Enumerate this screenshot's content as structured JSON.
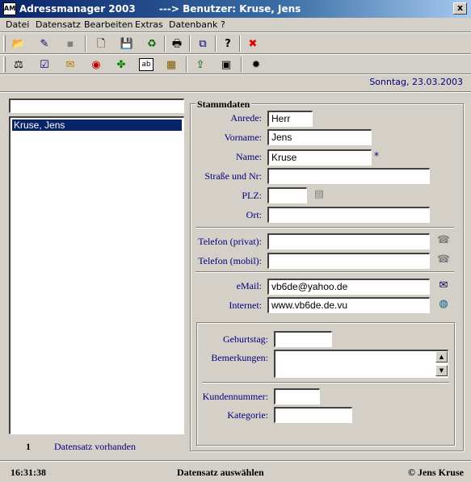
{
  "window": {
    "title": "Adressmanager 2003       ---> Benutzer: Kruse, Jens",
    "close_label": "x",
    "icon_label": "AM"
  },
  "menu": [
    "Datei",
    "Datensatz",
    "Bearbeiten",
    "Extras",
    "Datenbank",
    "?"
  ],
  "toolbar1": [
    {
      "icon": "open-folder-icon",
      "glyph": "📂"
    },
    {
      "icon": "edit-record-icon",
      "glyph": "✎"
    },
    {
      "icon": "box-icon",
      "glyph": "▪"
    },
    {
      "icon": "new-document-icon",
      "glyph": "🗋"
    },
    {
      "icon": "save-icon",
      "glyph": "💾"
    },
    {
      "icon": "recycle-icon",
      "glyph": "♻"
    },
    {
      "icon": "print-icon",
      "glyph": "🖶"
    },
    {
      "icon": "copy-icon",
      "glyph": "⧉"
    },
    {
      "icon": "help-icon",
      "glyph": "?"
    },
    {
      "icon": "exit-icon",
      "glyph": "✖"
    }
  ],
  "toolbar2": [
    {
      "icon": "scale-icon",
      "glyph": "⚖"
    },
    {
      "icon": "checklist-icon",
      "glyph": "☑"
    },
    {
      "icon": "birthday-icon",
      "glyph": "✉"
    },
    {
      "icon": "view-icon",
      "glyph": "◉"
    },
    {
      "icon": "clover-icon",
      "glyph": "✤"
    },
    {
      "icon": "textfield-icon",
      "glyph": "ab"
    },
    {
      "icon": "database-icon",
      "glyph": "▦"
    },
    {
      "icon": "export-icon",
      "glyph": "⇪"
    },
    {
      "icon": "card-icon",
      "glyph": "▣"
    },
    {
      "icon": "settings-icon",
      "glyph": "✹"
    }
  ],
  "date": "Sonntag, 23.03.2003",
  "search": {
    "value": ""
  },
  "list": {
    "items": [
      "Kruse, Jens"
    ],
    "count": "1",
    "count_label": "Datensatz vorhanden"
  },
  "stammdaten": {
    "title": "Stammdaten",
    "anrede": {
      "label": "Anrede:",
      "value": "Herr"
    },
    "vorname": {
      "label": "Vorname:",
      "value": "Jens"
    },
    "name": {
      "label": "Name:",
      "value": "Kruse",
      "required_mark": "*"
    },
    "strasse": {
      "label": "Straße und Nr:",
      "value": ""
    },
    "plz": {
      "label": "PLZ:",
      "value": ""
    },
    "ort": {
      "label": "Ort:",
      "value": ""
    },
    "tel_privat": {
      "label": "Telefon (privat):",
      "value": ""
    },
    "tel_mobil": {
      "label": "Telefon (mobil):",
      "value": ""
    },
    "email": {
      "label": "eMail:",
      "value": "vb6de@yahoo.de"
    },
    "internet": {
      "label": "Internet:",
      "value": "www.vb6de.de.vu"
    },
    "geburtstag": {
      "label": "Geburtstag:",
      "value": ""
    },
    "bemerkungen": {
      "label": "Bemerkungen:",
      "value": ""
    },
    "kundennummer": {
      "label": "Kundennummer:",
      "value": ""
    },
    "kategorie": {
      "label": "Kategorie:",
      "value": ""
    }
  },
  "status": {
    "time": "16:31:38",
    "message": "Datensatz auswählen",
    "copyright": "© Jens Kruse"
  }
}
